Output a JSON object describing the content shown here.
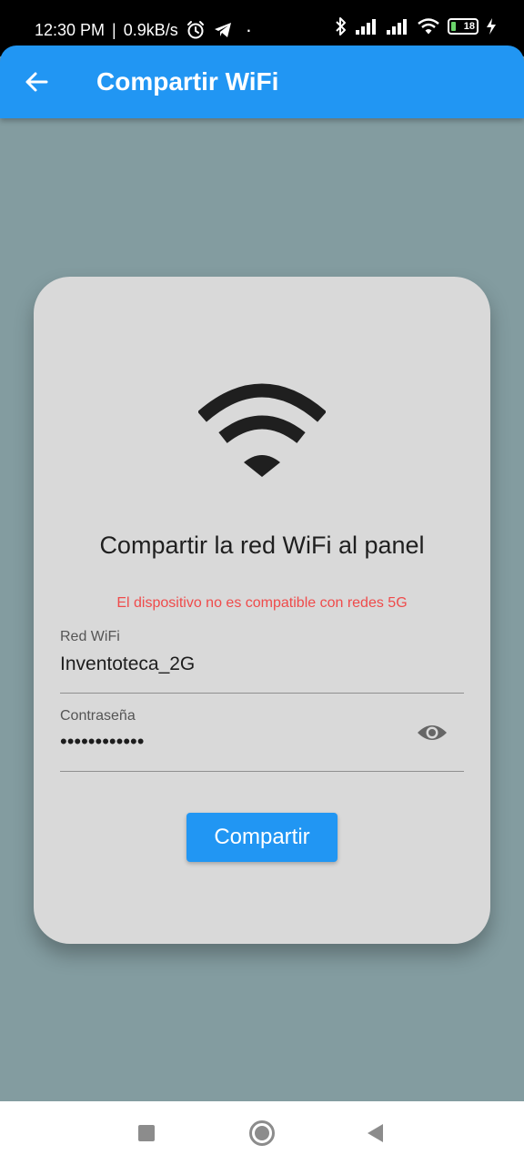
{
  "status_bar": {
    "time": "12:30 PM",
    "separator": "|",
    "net_speed": "0.9kB/s",
    "dot": "·",
    "battery_level": "18",
    "battery_fraction": 0.18,
    "icons": [
      "alarm-icon",
      "telegram-icon",
      "bluetooth-icon",
      "signal-icon",
      "signal-icon",
      "wifi-icon",
      "battery-icon",
      "charging-icon"
    ]
  },
  "app_bar": {
    "title": "Compartir WiFi",
    "back_icon": "arrow-left-icon"
  },
  "card": {
    "icon": "wifi-icon",
    "title": "Compartir la red WiFi al panel",
    "warning": "El dispositivo no es compatible con redes 5G",
    "ssid_label": "Red WiFi",
    "ssid_value": "Inventoteca_2G",
    "password_label": "Contraseña",
    "password_value": "••••••••••••",
    "visibility_icon": "eye-icon",
    "share_button": "Compartir"
  },
  "nav_bar": {
    "icons": [
      "recents-icon",
      "home-icon",
      "back-icon"
    ]
  },
  "colors": {
    "primary": "#2196f3",
    "background": "#839ca0",
    "card": "#d9d9d9",
    "warning": "#ef4b4b"
  }
}
